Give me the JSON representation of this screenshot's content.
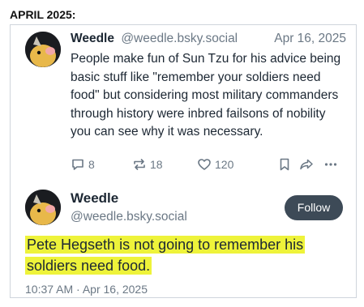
{
  "header_label": "APRIL 2025:",
  "reply_post": {
    "author_name": "Weedle",
    "author_handle": "@weedle.bsky.social",
    "date": "Apr 16, 2025",
    "text": "People make fun of Sun Tzu for his advice being basic stuff like \"remember your soldiers need food\" but considering most military commanders through history were inbred failsons of nobility you can see why it was necessary.",
    "reply_count": "8",
    "repost_count": "18",
    "like_count": "120",
    "icons": [
      "reply-icon",
      "repost-icon",
      "like-icon",
      "bookmark-icon",
      "share-icon",
      "more-icon"
    ]
  },
  "main_post": {
    "author_name": "Weedle",
    "author_handle": "@weedle.bsky.social",
    "follow_label": "Follow",
    "text": "Pete Hegseth is not going to remember his soldiers need food.",
    "timestamp": "10:37 AM · Apr 16, 2025"
  },
  "colors": {
    "highlight": "#eef33a",
    "follow_button": "#3d4a57",
    "muted_text": "#6b7885"
  }
}
